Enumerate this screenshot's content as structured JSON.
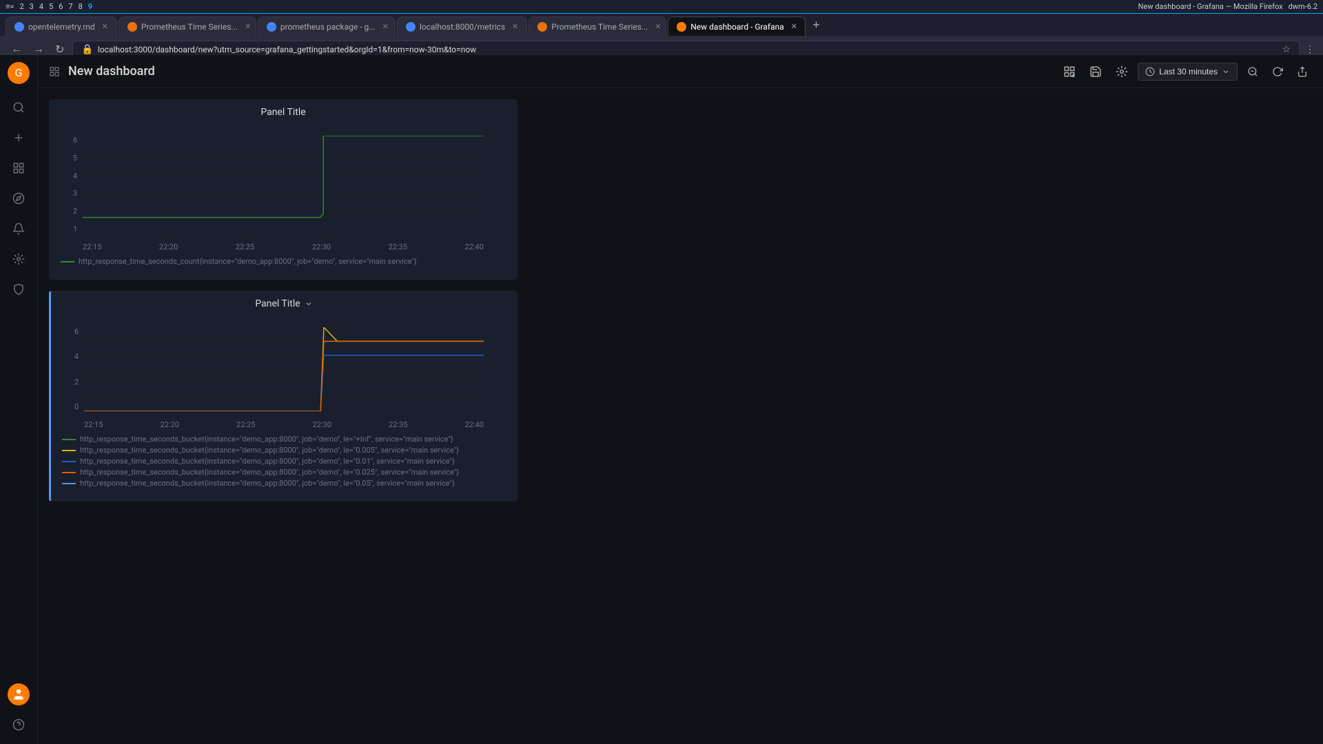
{
  "osbar": {
    "left": [
      "2",
      "3",
      "4",
      "5",
      "6",
      "7",
      "8"
    ],
    "active": "9",
    "right": "dwm-6.2"
  },
  "browser": {
    "tabs": [
      {
        "id": "tab1",
        "label": "opentelemetry.md",
        "favicon_color": "#4285f4",
        "active": false,
        "closable": true
      },
      {
        "id": "tab2",
        "label": "Prometheus Time Series...",
        "favicon_color": "#e8730a",
        "active": false,
        "closable": true
      },
      {
        "id": "tab3",
        "label": "prometheus package - g...",
        "favicon_color": "#4285f4",
        "active": false,
        "closable": true
      },
      {
        "id": "tab4",
        "label": "localhost:8000/metrics",
        "favicon_color": "#4285f4",
        "active": false,
        "closable": true
      },
      {
        "id": "tab5",
        "label": "Prometheus Time Series...",
        "favicon_color": "#e8730a",
        "active": false,
        "closable": true
      },
      {
        "id": "tab6",
        "label": "New dashboard - Grafana",
        "favicon_color": "#ff7c02",
        "active": true,
        "closable": true
      }
    ],
    "url": "localhost:3000/dashboard/new?utm_source=grafana_gettingstarted&orgId=1&from=now-30m&to=now"
  },
  "grafana": {
    "sidebar": {
      "items": [
        {
          "id": "search",
          "icon": "🔍",
          "label": "Search",
          "active": false
        },
        {
          "id": "new",
          "icon": "+",
          "label": "Create",
          "active": false
        },
        {
          "id": "dashboards",
          "icon": "⊞",
          "label": "Dashboards",
          "active": false
        },
        {
          "id": "explore",
          "icon": "🧭",
          "label": "Explore",
          "active": false
        },
        {
          "id": "alerting",
          "icon": "🔔",
          "label": "Alerting",
          "active": false
        },
        {
          "id": "config",
          "icon": "⚙",
          "label": "Configuration",
          "active": false
        },
        {
          "id": "shield",
          "icon": "🛡",
          "label": "Server Admin",
          "active": false
        }
      ],
      "bottom": [
        {
          "id": "help",
          "icon": "?",
          "label": "Help"
        }
      ]
    },
    "topbar": {
      "dashboard_icon": "⊞",
      "title": "New dashboard",
      "buttons": {
        "add_panel": "📊",
        "save": "💾",
        "settings": "⚙",
        "time_range": "Last 30 minutes",
        "zoom_out": "🔍",
        "refresh": "↻",
        "share": "📤"
      }
    },
    "panels": [
      {
        "id": "panel1",
        "title": "Panel Title",
        "has_chevron": false,
        "y_labels": [
          "6",
          "5",
          "4",
          "3",
          "2",
          "1"
        ],
        "x_labels": [
          "22:15",
          "22:20",
          "22:25",
          "22:30",
          "22:35",
          "22:40"
        ],
        "series": [
          {
            "color": "#37872d",
            "label": "http_response_time_seconds_count{instance=\"demo_app:8000\", job=\"demo\", service=\"main service\"}",
            "points": [
              [
                0,
                100
              ],
              [
                55,
                100
              ],
              [
                55,
                83
              ],
              [
                65,
                83
              ],
              [
                65,
                17
              ],
              [
                100,
                17
              ]
            ]
          }
        ]
      },
      {
        "id": "panel2",
        "title": "Panel Title",
        "has_chevron": true,
        "y_labels": [
          "6",
          "",
          "4",
          "",
          "2",
          "",
          "0"
        ],
        "x_labels": [
          "22:15",
          "22:20",
          "22:25",
          "22:30",
          "22:35",
          "22:40"
        ],
        "series": [
          {
            "color": "#37872d",
            "label": "http_response_time_seconds_bucket{instance=\"demo_app:8000\", job=\"demo\", le=\"+Inf\", service=\"main service\"}",
            "points": [
              [
                0,
                100
              ],
              [
                55,
                100
              ],
              [
                60,
                17
              ],
              [
                100,
                17
              ]
            ]
          },
          {
            "color": "#e0b400",
            "label": "http_response_time_seconds_bucket{instance=\"demo_app:8000\", job=\"demo\", le=\"0.005\", service=\"main service\"}",
            "points": [
              [
                0,
                100
              ],
              [
                55,
                100
              ],
              [
                60,
                40
              ],
              [
                100,
                40
              ]
            ]
          },
          {
            "color": "#1f60c4",
            "label": "http_response_time_seconds_bucket{instance=\"demo_app:8000\", job=\"demo\", le=\"0.01\", service=\"main service\"}",
            "points": [
              [
                0,
                100
              ],
              [
                55,
                100
              ],
              [
                60,
                40
              ],
              [
                100,
                40
              ]
            ]
          },
          {
            "color": "#e05f02",
            "label": "http_response_time_seconds_bucket{instance=\"demo_app:8000\", job=\"demo\", le=\"0.025\", service=\"main service\"}",
            "points": [
              [
                0,
                100
              ],
              [
                55,
                100
              ],
              [
                58,
                17
              ],
              [
                100,
                17
              ]
            ]
          },
          {
            "color": "#5794f2",
            "label": "http_response_time_seconds_bucket{instance=\"demo_app:8000\", job=\"demo\", le=\"0.05\", service=\"main service\"}",
            "points": [
              [
                0,
                100
              ],
              [
                55,
                100
              ],
              [
                60,
                40
              ],
              [
                100,
                40
              ]
            ]
          }
        ]
      }
    ]
  }
}
